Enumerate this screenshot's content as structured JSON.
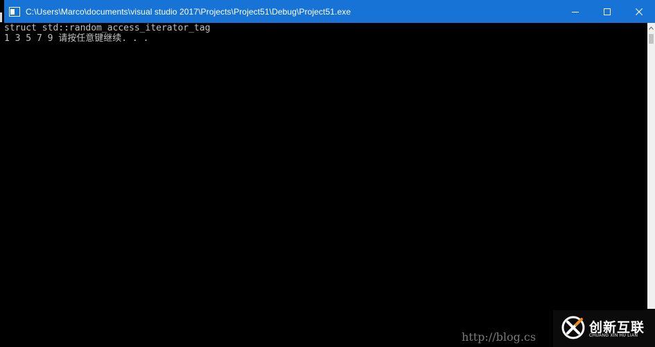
{
  "window": {
    "title": "C:\\Users\\Marco\\documents\\visual studio 2017\\Projects\\Project51\\Debug\\Project51.exe",
    "title_bar_color": "#1773d6",
    "controls": {
      "minimize_icon": "minimize-icon",
      "maximize_icon": "maximize-icon",
      "close_icon": "close-icon"
    }
  },
  "console": {
    "background": "#000000",
    "text_color": "#c0c0c0",
    "lines": [
      "struct std::random_access_iterator_tag",
      "1 3 5 7 9 请按任意键继续. . ."
    ]
  },
  "watermark": {
    "url_text": "http://blog.cs"
  },
  "logo": {
    "mark": "x-logo-icon",
    "name_cn": "创新互联",
    "name_en": "CHUANG XIN HU LIAN"
  }
}
